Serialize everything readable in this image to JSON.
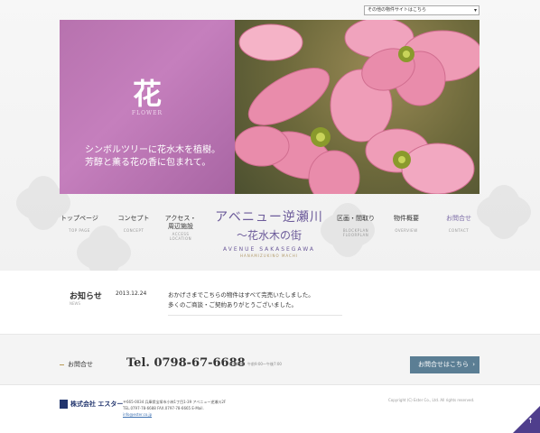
{
  "site_select": {
    "label": "その他の物件サイトはこちら"
  },
  "hero": {
    "kanji": "花",
    "english": "FLOWER",
    "copy_line1": "シンボルツリーに花水木を植樹。",
    "copy_line2": "芳醇と薫る花の香に包まれて。"
  },
  "nav": {
    "items": [
      {
        "jp": "トップページ",
        "en": "TOP PAGE"
      },
      {
        "jp": "コンセプト",
        "en": "CONCEPT"
      },
      {
        "jp": "アクセス・",
        "jp2": "周辺施設",
        "en": "ACCESS",
        "en2": "LOCATION"
      },
      {
        "jp": "区画・間取り",
        "en": "BLOCKPLAN",
        "en2": "FLOORPLAN"
      },
      {
        "jp": "物件概要",
        "en": "OVERVIEW"
      },
      {
        "jp": "お問合せ",
        "en": "CONTACT"
      }
    ]
  },
  "logo": {
    "line1": "アベニュー逆瀬川",
    "line2": "〜花水木の街",
    "line3": "AVENUE SAKASEGAWA",
    "line4": "HANAMIZUKINO MACHI"
  },
  "news": {
    "title": "お知らせ",
    "title_en": "NEWS",
    "date": "2013.12.24",
    "body1": "おかげさまでこちらの物件はすべて完売いたしました。",
    "body2": "多くのご商談・ご契約ありがとうございました。"
  },
  "contact": {
    "label": "お問合せ",
    "tel": "Tel. 0798-67-6688",
    "hours": "営業時間：午前9:00〜午後7:00",
    "button": "お問合せはこちら"
  },
  "footer": {
    "company": "株式会社 エスター",
    "addr1": "〒665-0034 兵庫県宝塚市小林1丁目1-39 アベニュー逆瀬川2F",
    "addr2_prefix": "TEL.0797-78-6688 FAX.0797-78-6665 E-Mail.",
    "email": "info@ester.co.jp",
    "copyright": "Copyright (C) Ester Co., Ltd. All rights reserved."
  },
  "colors": {
    "accent": "#6c5b9a",
    "button": "#5b7e94",
    "hero_purple": "#b772ae",
    "pagetop": "#4f3e8c"
  },
  "icons": {
    "select_arrow": "chevron-down-icon",
    "button_arrow": "chevron-right-icon",
    "pagetop": "arrow-up-icon"
  }
}
